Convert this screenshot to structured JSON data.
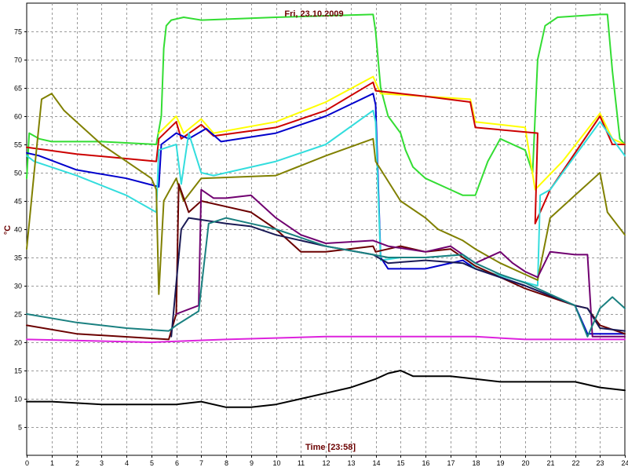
{
  "chart_data": {
    "type": "line",
    "title": "Fri, 23.10.2009",
    "xlabel": "Time [23:58]",
    "ylabel": "°C",
    "xlim": [
      0,
      24
    ],
    "ylim": [
      0,
      80
    ],
    "x_ticks": [
      "0",
      "1",
      "2",
      "3",
      "4",
      "5",
      "6",
      "7",
      "8",
      "9",
      "10",
      "11",
      "12",
      "13",
      "14",
      "15",
      "16",
      "17",
      "18",
      "19",
      "20",
      "21",
      "22",
      "23",
      "24"
    ],
    "y_ticks": [
      "5",
      "10",
      "15",
      "20",
      "25",
      "30",
      "35",
      "40",
      "45",
      "50",
      "55",
      "60",
      "65",
      "70",
      "75"
    ],
    "grid": true,
    "legend": "none",
    "series": [
      {
        "color": "#33dd33",
        "points": [
          [
            0,
            49
          ],
          [
            0.1,
            57
          ],
          [
            0.5,
            56
          ],
          [
            1,
            55.5
          ],
          [
            3,
            55.5
          ],
          [
            5.2,
            55
          ],
          [
            5.4,
            60
          ],
          [
            5.5,
            72
          ],
          [
            5.6,
            76
          ],
          [
            5.8,
            77
          ],
          [
            6.3,
            77.5
          ],
          [
            7,
            77
          ],
          [
            10,
            77.5
          ],
          [
            13.9,
            78
          ],
          [
            14,
            75
          ],
          [
            14.2,
            65
          ],
          [
            14.5,
            60
          ],
          [
            15,
            57
          ],
          [
            15.2,
            54
          ],
          [
            15.5,
            51
          ],
          [
            16,
            49
          ],
          [
            17,
            47
          ],
          [
            17.5,
            46
          ],
          [
            18,
            46
          ],
          [
            18.5,
            52
          ],
          [
            19,
            56
          ],
          [
            20,
            54
          ],
          [
            20.3,
            50
          ],
          [
            20.4,
            60
          ],
          [
            20.5,
            70
          ],
          [
            20.8,
            76
          ],
          [
            21.3,
            77.5
          ],
          [
            23,
            78
          ],
          [
            23.3,
            78
          ],
          [
            23.5,
            68
          ],
          [
            23.8,
            56
          ],
          [
            24,
            55
          ]
        ]
      },
      {
        "color": "#ffff00",
        "points": [
          [
            5.3,
            57
          ],
          [
            6,
            60
          ],
          [
            6.3,
            57
          ],
          [
            7,
            59.5
          ],
          [
            7.5,
            57
          ],
          [
            10,
            59
          ],
          [
            12,
            62.5
          ],
          [
            13.9,
            67
          ],
          [
            14.2,
            64
          ],
          [
            17.8,
            63
          ],
          [
            18,
            59
          ],
          [
            20,
            58
          ],
          [
            20.4,
            47
          ],
          [
            21.5,
            52
          ],
          [
            23,
            60.5
          ],
          [
            23.5,
            56
          ],
          [
            24,
            55
          ]
        ]
      },
      {
        "color": "#cc0000",
        "points": [
          [
            0,
            54.5
          ],
          [
            2,
            53.3
          ],
          [
            5.2,
            52
          ],
          [
            5.3,
            56
          ],
          [
            6,
            59
          ],
          [
            6.2,
            56
          ],
          [
            7,
            58.5
          ],
          [
            7.5,
            56.5
          ],
          [
            10,
            58
          ],
          [
            12,
            61
          ],
          [
            13.9,
            66
          ],
          [
            14,
            64.5
          ],
          [
            16,
            63.5
          ],
          [
            17.8,
            62.5
          ],
          [
            18,
            58
          ],
          [
            20.5,
            57
          ],
          [
            20.4,
            41
          ],
          [
            21,
            47
          ],
          [
            23,
            60
          ],
          [
            23.5,
            55
          ],
          [
            24,
            55
          ]
        ]
      },
      {
        "color": "#0000cc",
        "points": [
          [
            0,
            53.5
          ],
          [
            0.5,
            53
          ],
          [
            2,
            50.5
          ],
          [
            4,
            49
          ],
          [
            5.3,
            47.5
          ],
          [
            5.4,
            55
          ],
          [
            6,
            57
          ],
          [
            6.5,
            56
          ],
          [
            7.2,
            57.8
          ],
          [
            7.8,
            55.5
          ],
          [
            10,
            57
          ],
          [
            12,
            60
          ],
          [
            13.9,
            64
          ],
          [
            14,
            62
          ],
          [
            14.2,
            35
          ],
          [
            14.5,
            33
          ],
          [
            16,
            33
          ],
          [
            17.5,
            34.5
          ],
          [
            18,
            33
          ],
          [
            20,
            30
          ],
          [
            22,
            26.5
          ],
          [
            22.5,
            21.5
          ],
          [
            24,
            21.5
          ]
        ]
      },
      {
        "color": "#33dddd",
        "points": [
          [
            0,
            53
          ],
          [
            0.3,
            52
          ],
          [
            2,
            49.5
          ],
          [
            4,
            46
          ],
          [
            5.2,
            43
          ],
          [
            5.3,
            54
          ],
          [
            6,
            55
          ],
          [
            6.2,
            48
          ],
          [
            6.5,
            57
          ],
          [
            7,
            50
          ],
          [
            7.5,
            49.5
          ],
          [
            10,
            52
          ],
          [
            12,
            55
          ],
          [
            13.9,
            61
          ],
          [
            14,
            59
          ],
          [
            14.2,
            34.5
          ],
          [
            15,
            35
          ],
          [
            16,
            35
          ],
          [
            17.5,
            35.5
          ],
          [
            18,
            33
          ],
          [
            20.5,
            30
          ],
          [
            20.6,
            46
          ],
          [
            21,
            47
          ],
          [
            23,
            59
          ],
          [
            23.5,
            56
          ],
          [
            24,
            53
          ]
        ]
      },
      {
        "color": "#808000",
        "points": [
          [
            0,
            36.5
          ],
          [
            0.3,
            50
          ],
          [
            0.6,
            63
          ],
          [
            1,
            64
          ],
          [
            1.5,
            61
          ],
          [
            2,
            59
          ],
          [
            3,
            55
          ],
          [
            4,
            52
          ],
          [
            5,
            49
          ],
          [
            5.2,
            47
          ],
          [
            5.3,
            28.5
          ],
          [
            5.5,
            45
          ],
          [
            6,
            49
          ],
          [
            6.3,
            45
          ],
          [
            7,
            49
          ],
          [
            10,
            49.5
          ],
          [
            12,
            53
          ],
          [
            13.9,
            56
          ],
          [
            14,
            52
          ],
          [
            15,
            45
          ],
          [
            16,
            42
          ],
          [
            16.5,
            40
          ],
          [
            17,
            39
          ],
          [
            17.5,
            38
          ],
          [
            18,
            36.5
          ],
          [
            19,
            34
          ],
          [
            20,
            32
          ],
          [
            20.5,
            31
          ],
          [
            21,
            42
          ],
          [
            22,
            46
          ],
          [
            23,
            50
          ],
          [
            23.3,
            43
          ],
          [
            24,
            39
          ]
        ]
      },
      {
        "color": "#6b0000",
        "points": [
          [
            0,
            23
          ],
          [
            2,
            21.5
          ],
          [
            5.7,
            20.5
          ],
          [
            6,
            25
          ],
          [
            6.1,
            48
          ],
          [
            6.5,
            43
          ],
          [
            7,
            45
          ],
          [
            8,
            44
          ],
          [
            9,
            43
          ],
          [
            10,
            40
          ],
          [
            11,
            36
          ],
          [
            12,
            36
          ],
          [
            13.9,
            37
          ],
          [
            14,
            36
          ],
          [
            15,
            37
          ],
          [
            16,
            36
          ],
          [
            17,
            36.5
          ],
          [
            18,
            33.5
          ],
          [
            20,
            29.5
          ],
          [
            22,
            26.5
          ],
          [
            22.5,
            26
          ],
          [
            23,
            23
          ],
          [
            24,
            21.5
          ]
        ]
      },
      {
        "color": "#700070",
        "points": [
          [
            6,
            25
          ],
          [
            6.6,
            26
          ],
          [
            6.9,
            26.5
          ],
          [
            7,
            47
          ],
          [
            7.5,
            45.5
          ],
          [
            8,
            45.5
          ],
          [
            9,
            46
          ],
          [
            10,
            42
          ],
          [
            11,
            39
          ],
          [
            12,
            37.5
          ],
          [
            13.9,
            38
          ],
          [
            14.5,
            37
          ],
          [
            16,
            36
          ],
          [
            17,
            37
          ],
          [
            18,
            34
          ],
          [
            19,
            36
          ],
          [
            19.5,
            34
          ],
          [
            20,
            32.5
          ],
          [
            20.5,
            31.5
          ],
          [
            21,
            36
          ],
          [
            22,
            35.5
          ],
          [
            22.5,
            35.5
          ],
          [
            22.7,
            21
          ],
          [
            24,
            21
          ]
        ]
      },
      {
        "color": "#1a1a55",
        "points": [
          [
            5.8,
            21
          ],
          [
            6.2,
            40
          ],
          [
            6.5,
            42
          ],
          [
            8,
            41
          ],
          [
            9,
            40.5
          ],
          [
            10,
            39
          ],
          [
            11,
            38
          ],
          [
            12,
            37
          ],
          [
            13.9,
            35.5
          ],
          [
            14.5,
            34
          ],
          [
            16,
            34.5
          ],
          [
            17.5,
            34
          ],
          [
            18,
            33
          ],
          [
            19,
            31.5
          ],
          [
            20,
            30
          ],
          [
            22,
            26.5
          ],
          [
            22.5,
            26
          ],
          [
            23,
            22.5
          ],
          [
            24,
            22
          ]
        ]
      },
      {
        "color": "#1a8080",
        "points": [
          [
            0,
            25
          ],
          [
            2,
            23.5
          ],
          [
            4,
            22.5
          ],
          [
            5.7,
            22
          ],
          [
            6,
            23
          ],
          [
            6.9,
            25.5
          ],
          [
            7.3,
            41
          ],
          [
            8,
            42
          ],
          [
            9,
            41
          ],
          [
            10,
            40
          ],
          [
            11,
            38.5
          ],
          [
            12,
            37
          ],
          [
            13.9,
            35.5
          ],
          [
            14.5,
            35
          ],
          [
            16,
            35
          ],
          [
            17.5,
            35.5
          ],
          [
            18,
            34
          ],
          [
            19,
            32
          ],
          [
            20,
            30.5
          ],
          [
            22,
            26.5
          ],
          [
            22.5,
            21
          ],
          [
            23,
            26
          ],
          [
            23.5,
            28
          ],
          [
            24,
            26
          ]
        ]
      },
      {
        "color": "#dd22dd",
        "points": [
          [
            0,
            20.5
          ],
          [
            5,
            20
          ],
          [
            8,
            20.5
          ],
          [
            12,
            21
          ],
          [
            16,
            21
          ],
          [
            18,
            21
          ],
          [
            20,
            20.5
          ],
          [
            24,
            20.5
          ]
        ]
      },
      {
        "color": "#000000",
        "points": [
          [
            0,
            9.5
          ],
          [
            1,
            9.5
          ],
          [
            3,
            9
          ],
          [
            5,
            9
          ],
          [
            6,
            9
          ],
          [
            7,
            9.5
          ],
          [
            8,
            8.5
          ],
          [
            9,
            8.5
          ],
          [
            10,
            9
          ],
          [
            11,
            10
          ],
          [
            12,
            11
          ],
          [
            13,
            12
          ],
          [
            14,
            13.5
          ],
          [
            14.5,
            14.5
          ],
          [
            15,
            15
          ],
          [
            15.5,
            14
          ],
          [
            17,
            14
          ],
          [
            18,
            13.5
          ],
          [
            19,
            13
          ],
          [
            20,
            13
          ],
          [
            21,
            13
          ],
          [
            22,
            13
          ],
          [
            23,
            12
          ],
          [
            24,
            11.5
          ]
        ]
      }
    ]
  }
}
